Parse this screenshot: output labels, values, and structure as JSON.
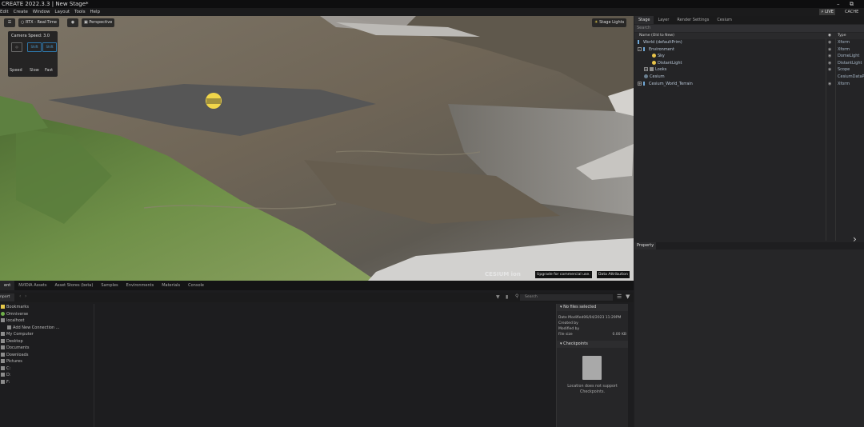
{
  "titlebar": {
    "title": "CREATE  2022.3.3 | New Stage*",
    "minimize": "–",
    "restore": "⧉"
  },
  "menubar": {
    "items": [
      "Edit",
      "Create",
      "Window",
      "Layout",
      "Tools",
      "Help"
    ],
    "live": "⚡ LIVE",
    "cache": "CACHE"
  },
  "viewport": {
    "render_mode": "RTX - Real-Time",
    "camera": "Perspective",
    "stage_lights": "Stage Lights",
    "camera_speed_label": "Camera Speed: 3.0",
    "speed_label": "Speed",
    "slow_label": "Slow",
    "fast_label": "Fast",
    "slow_key": "Shift",
    "fast_key": "Shift",
    "cesium_logo": "CESIUM ion",
    "upgrade_button": "Upgrade for commercial use.",
    "attribution_button": "Data Attribution"
  },
  "stage": {
    "tabs": [
      "Stage",
      "Layer",
      "Render Settings",
      "Cesium"
    ],
    "search_placeholder": "Search",
    "col_name": "Name (Old to New)",
    "col_type": "Type",
    "rows": [
      {
        "name": "World (defaultPrim)",
        "type": "Xform",
        "indent": 0,
        "icon": "xform"
      },
      {
        "name": "Environment",
        "type": "Xform",
        "indent": 1,
        "icon": "xform"
      },
      {
        "name": "Sky",
        "type": "DomeLight",
        "indent": 2,
        "icon": "light"
      },
      {
        "name": "DistantLight",
        "type": "DistantLight",
        "indent": 2,
        "icon": "light"
      },
      {
        "name": "Looks",
        "type": "Scope",
        "indent": 1,
        "icon": "folder"
      },
      {
        "name": "Cesium",
        "type": "CesiumDataP",
        "indent": 0,
        "icon": "dot"
      },
      {
        "name": "Cesium_World_Terrain",
        "type": "Xform",
        "indent": 0,
        "icon": "xform"
      }
    ]
  },
  "property": {
    "tab": "Property"
  },
  "bottom": {
    "tabs": [
      "ent",
      "NVIDIA Assets",
      "Asset Stores (beta)",
      "Samples",
      "Environments",
      "Materials",
      "Console"
    ],
    "import_label": "nport",
    "search_placeholder": "Search",
    "tree": [
      "Bookmarks",
      "Omniverse",
      "localhost",
      "Add New Connection ...",
      "My Computer",
      "Desktop",
      "Documents",
      "Downloads",
      "Pictures",
      "C:",
      "D:",
      "F:"
    ],
    "details": {
      "no_files": "No files selected",
      "date_modified_label": "Date Modified",
      "date_modified": "06/04/2023 11:29PM",
      "created_by_label": "Created by",
      "modified_by_label": "Modified by",
      "file_size_label": "File size",
      "file_size": "0.00 KB",
      "checkpoints": "Checkpoints",
      "checkpoint_note": "Location does not support Checkpoints."
    }
  }
}
